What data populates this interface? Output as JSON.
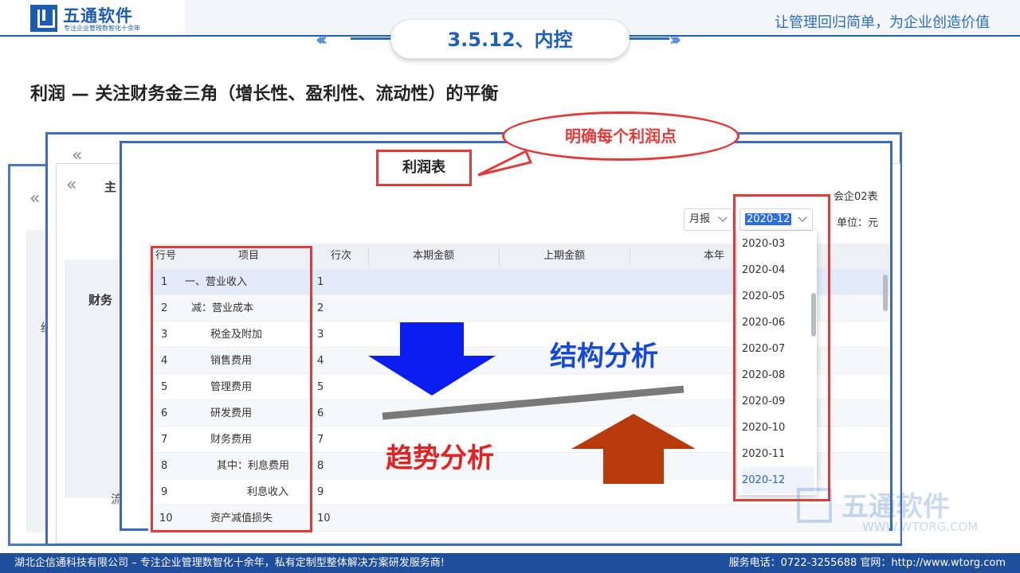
{
  "header": {
    "logo_text": "五通软件",
    "logo_sub": "专注企业管理数智化十余年",
    "slogan": "让管理回归简单，为企业创造价值",
    "section_title": "3.5.12、内控"
  },
  "heading": "利润 — 关注财务金三角（增长性、盈利性、流动性）的平衡",
  "background_windows": {
    "partial_text_1": "主",
    "partial_text_2": "财务",
    "partial_text_3": "经",
    "partial_text_4": "流"
  },
  "report": {
    "title": "利润表",
    "form_code": "会企02表",
    "unit": "单位：元",
    "period_type": "月报",
    "selected_period": "2020-12"
  },
  "table": {
    "headers": [
      "行号",
      "项目",
      "行次",
      "本期金额",
      "上期金额",
      "本年"
    ],
    "rows": [
      {
        "no": "1",
        "item": "一、营业收入",
        "line": "1"
      },
      {
        "no": "2",
        "item": "减：营业成本",
        "line": "2"
      },
      {
        "no": "3",
        "item": "税金及附加",
        "line": "3"
      },
      {
        "no": "4",
        "item": "销售费用",
        "line": "4"
      },
      {
        "no": "5",
        "item": "管理费用",
        "line": "5"
      },
      {
        "no": "6",
        "item": "研发费用",
        "line": "6"
      },
      {
        "no": "7",
        "item": "财务费用",
        "line": "7"
      },
      {
        "no": "8",
        "item": "其中：利息费用",
        "line": "8"
      },
      {
        "no": "9",
        "item": "利息收入",
        "line": "9"
      },
      {
        "no": "10",
        "item": "资产减值损失",
        "line": "10"
      }
    ]
  },
  "period_options": [
    "2020-03",
    "2020-04",
    "2020-05",
    "2020-06",
    "2020-07",
    "2020-08",
    "2020-09",
    "2020-10",
    "2020-11",
    "2020-12"
  ],
  "annotations": {
    "callout": "明确每个利润点",
    "structure": "结构分析",
    "trend": "趋势分析"
  },
  "colors": {
    "brand_blue": "#1b5bb0",
    "annotation_red": "#e03b3b",
    "structure_blue": "#1649d6",
    "trend_arrow": "#b83a0c",
    "footer_bg": "#1f4e9c"
  },
  "watermark": {
    "text": "五通软件",
    "url": "WWW.WTORG.COM"
  },
  "footer": {
    "company": "湖北企信通科技有限公司 – 专注企业管理数智化十余年，私有定制型整体解决方案研发服务商!",
    "contact": "服务电话：0722-3255688  官网：http://www.wtorg.com"
  }
}
